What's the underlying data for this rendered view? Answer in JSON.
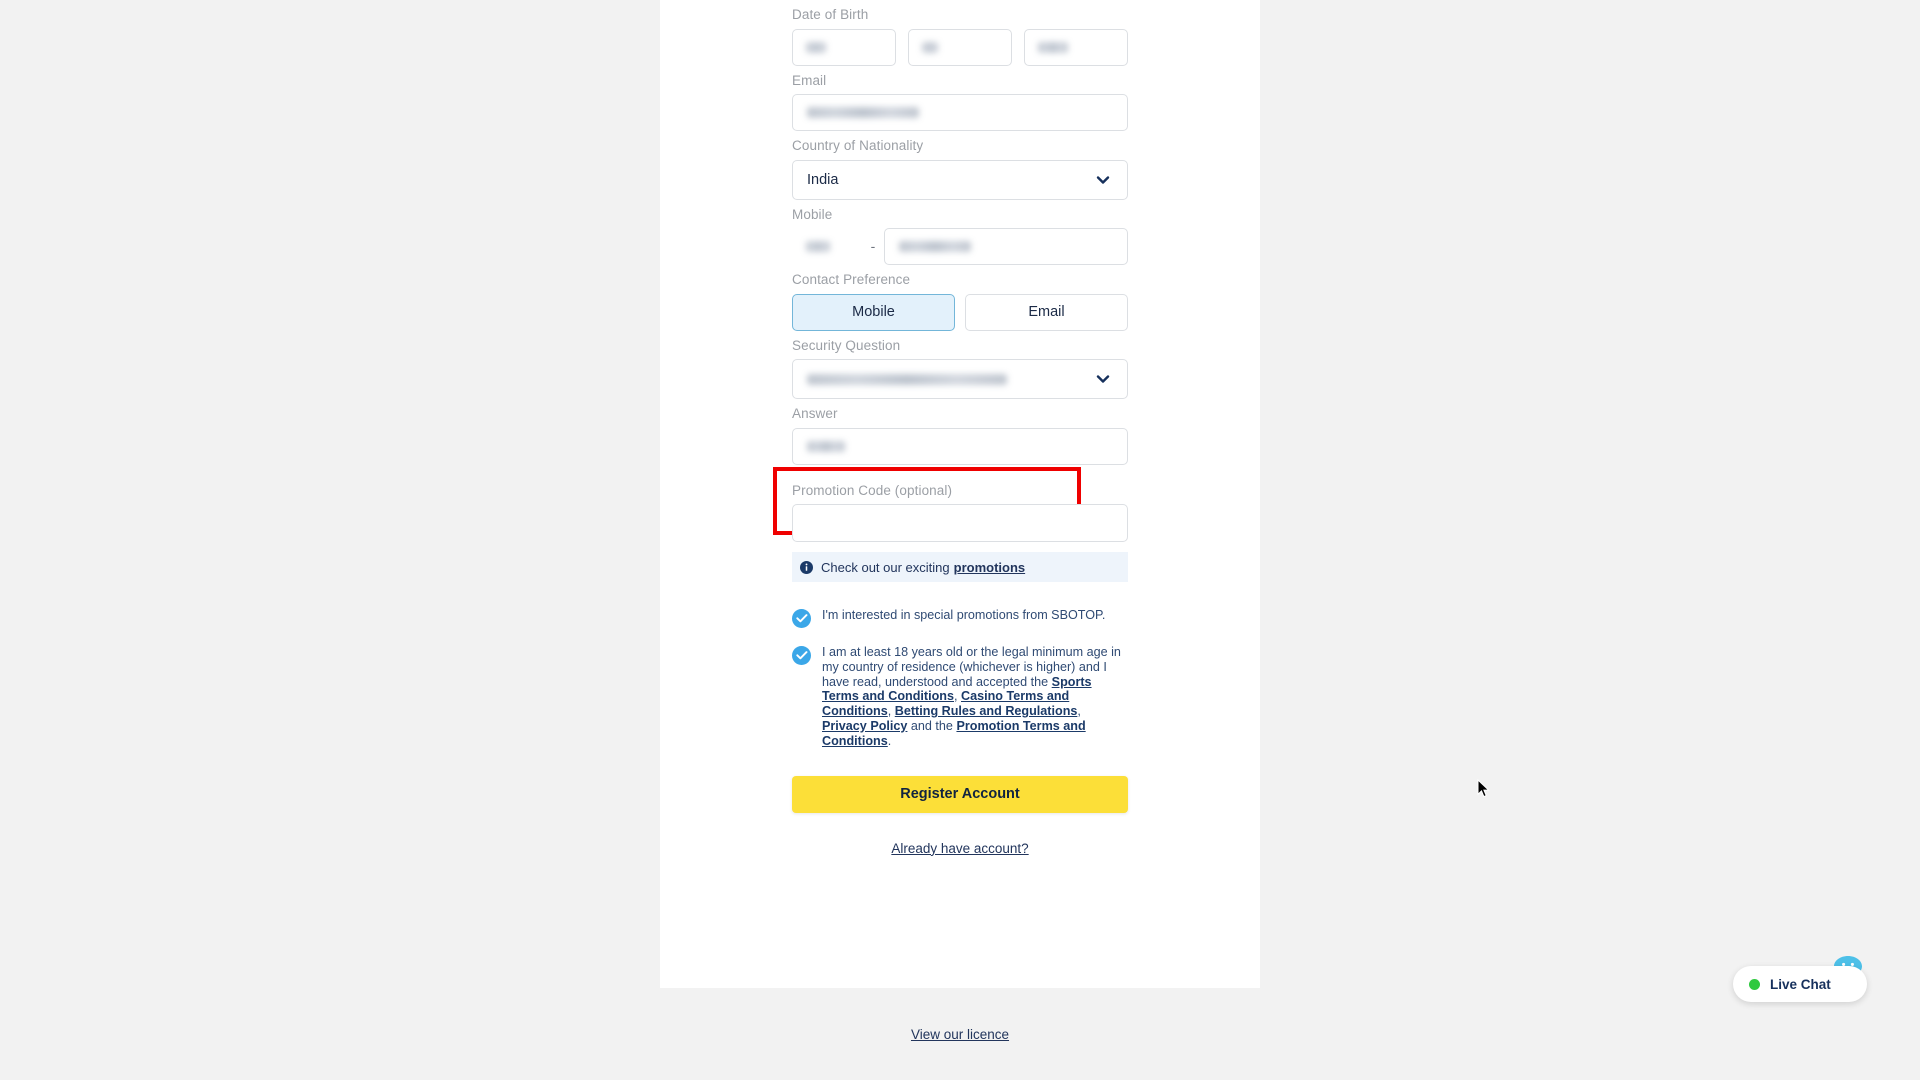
{
  "form": {
    "date_of_birth": {
      "label": "Date of Birth",
      "day": "",
      "month": "",
      "year": ""
    },
    "email": {
      "label": "Email",
      "value": ""
    },
    "country": {
      "label": "Country of Nationality",
      "value": "India"
    },
    "mobile": {
      "label": "Mobile",
      "country_code": "",
      "separator": "-",
      "number": ""
    },
    "contact_preference": {
      "label": "Contact Preference",
      "options": [
        "Mobile",
        "Email"
      ],
      "selected": "Mobile"
    },
    "security_question": {
      "label": "Security Question",
      "value": ""
    },
    "answer": {
      "label": "Answer",
      "value": ""
    },
    "promotion_code": {
      "label": "Promotion Code (optional)",
      "value": "",
      "placeholder": ""
    }
  },
  "info_banner": {
    "text": "Check out our exciting",
    "link": "promotions"
  },
  "consents": [
    {
      "checked": true,
      "text": "I'm interested in special promotions from SBOTOP."
    },
    {
      "checked": true,
      "text_part1": "I am at least 18 years old or the legal minimum age in my country of residence (whichever is higher) and I have read, understood and accepted the ",
      "link1": "Sports Terms and Conditions",
      "sep1": ", ",
      "link2": "Casino Terms and Conditions",
      "sep2": ", ",
      "link3": "Betting Rules and Regulations",
      "sep3": ", ",
      "link4": "Privacy Policy",
      "sep4": " and the ",
      "link5": "Promotion Terms and Conditions",
      "sep5": "."
    }
  ],
  "actions": {
    "register_label": "Register Account",
    "already_have_account": "Already have account?"
  },
  "footer": {
    "licence_link": "View our licence"
  },
  "live_chat": {
    "label": "Live Chat",
    "status_color": "#2ec93f"
  },
  "colors": {
    "highlight_box": "#ef0000",
    "register_button": "#fcdf38",
    "checkbox": "#3ba7e8",
    "active_segment": "#e3f1fb"
  }
}
